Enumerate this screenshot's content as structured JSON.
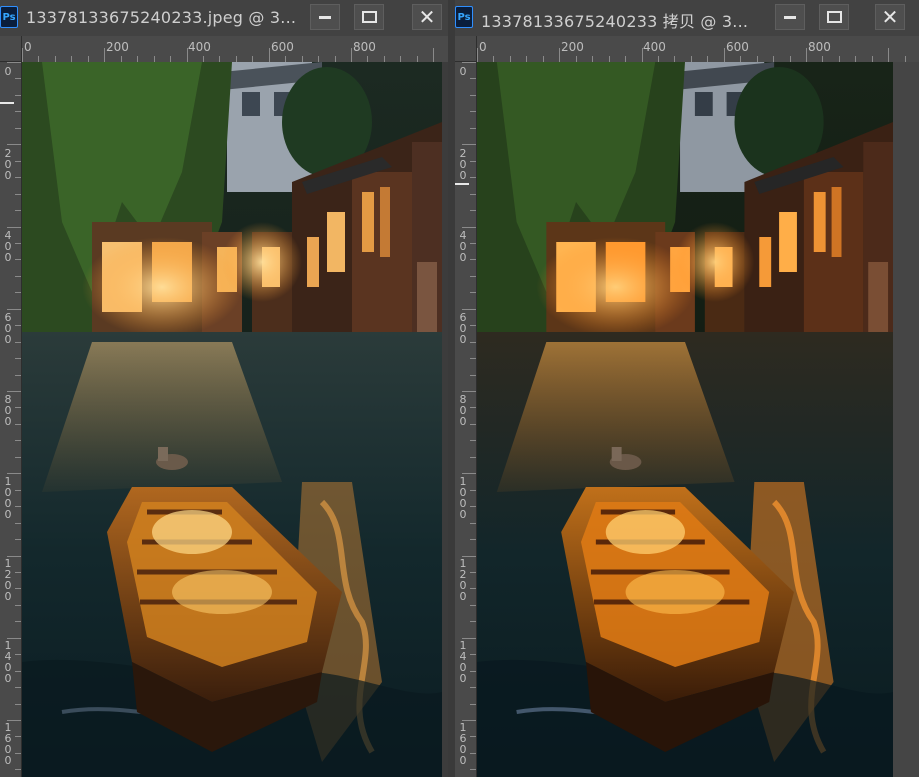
{
  "app": {
    "icon": "photoshop-icon",
    "badge": "Ps"
  },
  "windows": [
    {
      "title": "13378133675240233.jpeg @ 3...",
      "buttons": {
        "minimize": "minimize-icon",
        "maximize": "maximize-icon",
        "close": "close-icon"
      },
      "ruler_h": [
        "0",
        "200",
        "400",
        "600",
        "800"
      ],
      "ruler_v": [
        "0",
        "200",
        "400",
        "600",
        "800",
        "1000",
        "1200",
        "1400",
        "1600"
      ],
      "image_label": "Canal night scene with wooden boat (original)"
    },
    {
      "title": "13378133675240233 拷贝 @ 3...",
      "buttons": {
        "minimize": "minimize-icon",
        "maximize": "maximize-icon",
        "close": "close-icon"
      },
      "ruler_h": [
        "0",
        "200",
        "400",
        "600",
        "800"
      ],
      "ruler_v": [
        "0",
        "200",
        "400",
        "600",
        "800",
        "1000",
        "1200",
        "1400",
        "1600"
      ],
      "image_label": "Canal night scene with wooden boat (copy, warmer)"
    }
  ],
  "colors": {
    "chrome": "#424242",
    "ruler": "#4a4a4a",
    "ps_blue": "#35a6ff",
    "lamp_warm": "#ffb347",
    "water_dark": "#0f2a2f"
  }
}
